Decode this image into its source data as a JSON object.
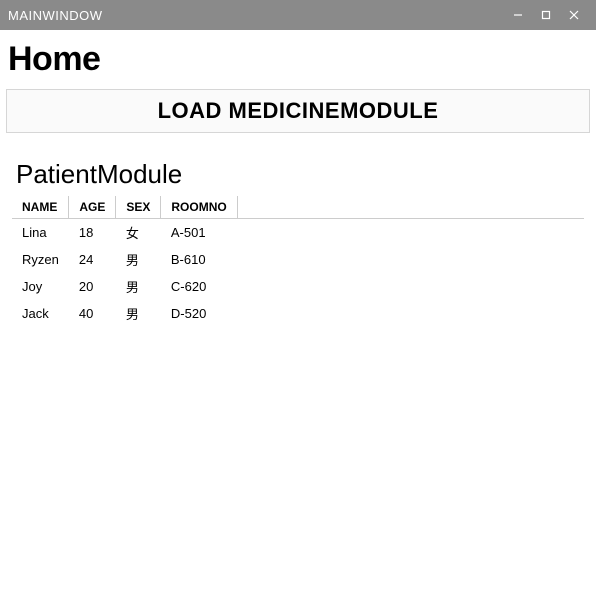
{
  "window": {
    "title": "MAINWINDOW"
  },
  "header": {
    "heading": "Home",
    "load_button_label": "LOAD MEDICINEMODULE"
  },
  "module": {
    "title": "PatientModule",
    "columns": {
      "name": "NAME",
      "age": "AGE",
      "sex": "SEX",
      "roomno": "ROOMNO"
    },
    "rows": [
      {
        "name": "Lina",
        "age": "18",
        "sex": "女",
        "roomno": "A-501"
      },
      {
        "name": "Ryzen",
        "age": "24",
        "sex": "男",
        "roomno": "B-610"
      },
      {
        "name": "Joy",
        "age": "20",
        "sex": "男",
        "roomno": "C-620"
      },
      {
        "name": "Jack",
        "age": "40",
        "sex": "男",
        "roomno": "D-520"
      }
    ]
  }
}
